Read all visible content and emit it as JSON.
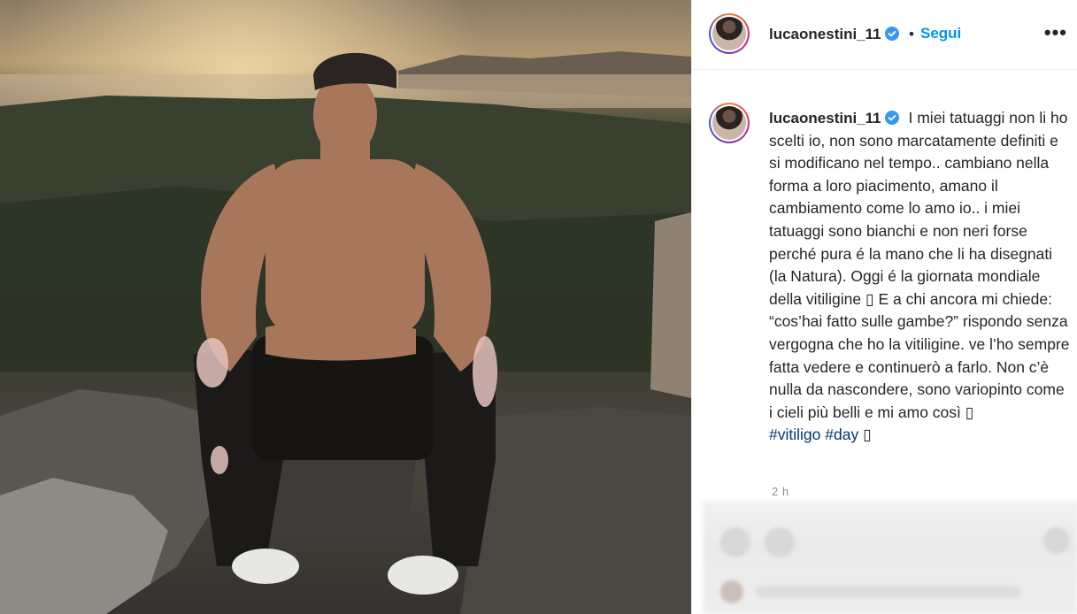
{
  "post": {
    "image": {
      "description_icon": "photo-icon"
    }
  },
  "header": {
    "username": "lucaonestini_11",
    "separator": "•",
    "follow_label": "Segui",
    "more_label": "•••"
  },
  "caption": {
    "username": "lucaonestini_11",
    "text": "I miei tatuaggi non li ho scelti io, non sono marcatamente definiti e si modificano nel tempo.. cambiano nella forma a loro piacimento, amano il cambiamento come lo amo io.. i miei tatuaggi sono bianchi e non neri forse perché pura é la mano che li ha disegnati (la Natura). Oggi é la giornata mondiale della vitiligine ▯ E a chi ancora mi chiede: “cos’hai fatto sulle gambe?” rispondo senza vergogna che ho la vitiligine. ve l’ho sempre fatta vedere e continuerò a farlo. Non c’è nulla da nascondere, sono variopinto come i cieli più belli e mi amo così ▯",
    "hashtag1": "#vitiligo",
    "hashtag2": "#day",
    "trailing": "▯"
  },
  "timestamp": "2 h",
  "colors": {
    "accent": "#0095f6",
    "hashtag": "#00376b",
    "verified": "#3897f0"
  }
}
